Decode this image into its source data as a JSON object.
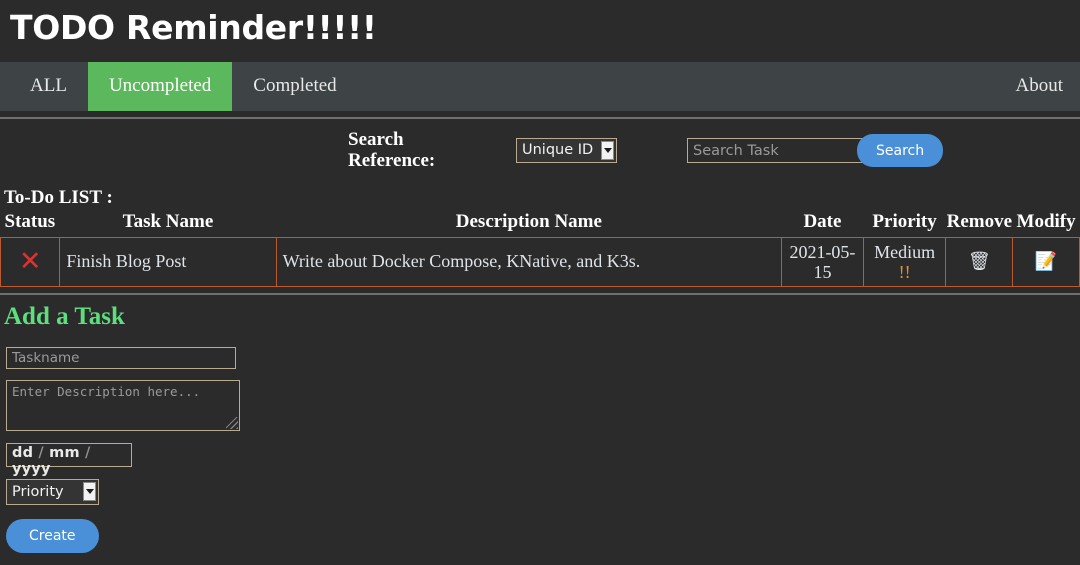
{
  "header": {
    "title": "TODO Reminder!!!!!"
  },
  "nav": {
    "items": [
      {
        "label": "ALL",
        "active": false
      },
      {
        "label": "Uncompleted",
        "active": true
      },
      {
        "label": "Completed",
        "active": false
      }
    ],
    "right_label": "About"
  },
  "search": {
    "label": "Search Reference:",
    "reference_selected": "Unique ID",
    "reference_options": [
      "Unique ID"
    ],
    "input_value": "",
    "input_placeholder": "Search Task",
    "button_label": "Search"
  },
  "todo_list": {
    "title": "To-Do LIST :",
    "columns": [
      "Status",
      "Task Name",
      "Description Name",
      "Date",
      "Priority",
      "Remove",
      "Modify"
    ],
    "rows": [
      {
        "status_icon": "cross-mark",
        "status_glyph": "✕",
        "task_name": "Finish Blog Post",
        "description": "Write about Docker Compose, KNative, and K3s.",
        "date": "2021-05-15",
        "priority": "Medium",
        "priority_bangs": "!!",
        "remove_icon": "wastebasket-icon",
        "remove_glyph": "🗑",
        "modify_icon": "memo-icon",
        "modify_glyph": "📝"
      }
    ]
  },
  "add_task": {
    "title": "Add a Task",
    "taskname_value": "",
    "taskname_placeholder": "Taskname",
    "description_value": "",
    "description_placeholder": "Enter Description here...",
    "date_dd": "dd",
    "date_mm": "mm",
    "date_yyyy": "yyyy",
    "date_separator": "/",
    "priority_selected": "Priority",
    "priority_options": [
      "Priority"
    ],
    "create_label": "Create"
  },
  "colors": {
    "page_background": "#2b2b2b",
    "nav_background": "#3e4445",
    "accent_green": "#5cb85c",
    "heading_green": "#5cdf7c",
    "table_border": "#bb5b2d",
    "button_blue": "#4a90d9",
    "priority_orange": "#e8912d",
    "status_red": "#e03030",
    "input_border": "#b8ab8f"
  }
}
